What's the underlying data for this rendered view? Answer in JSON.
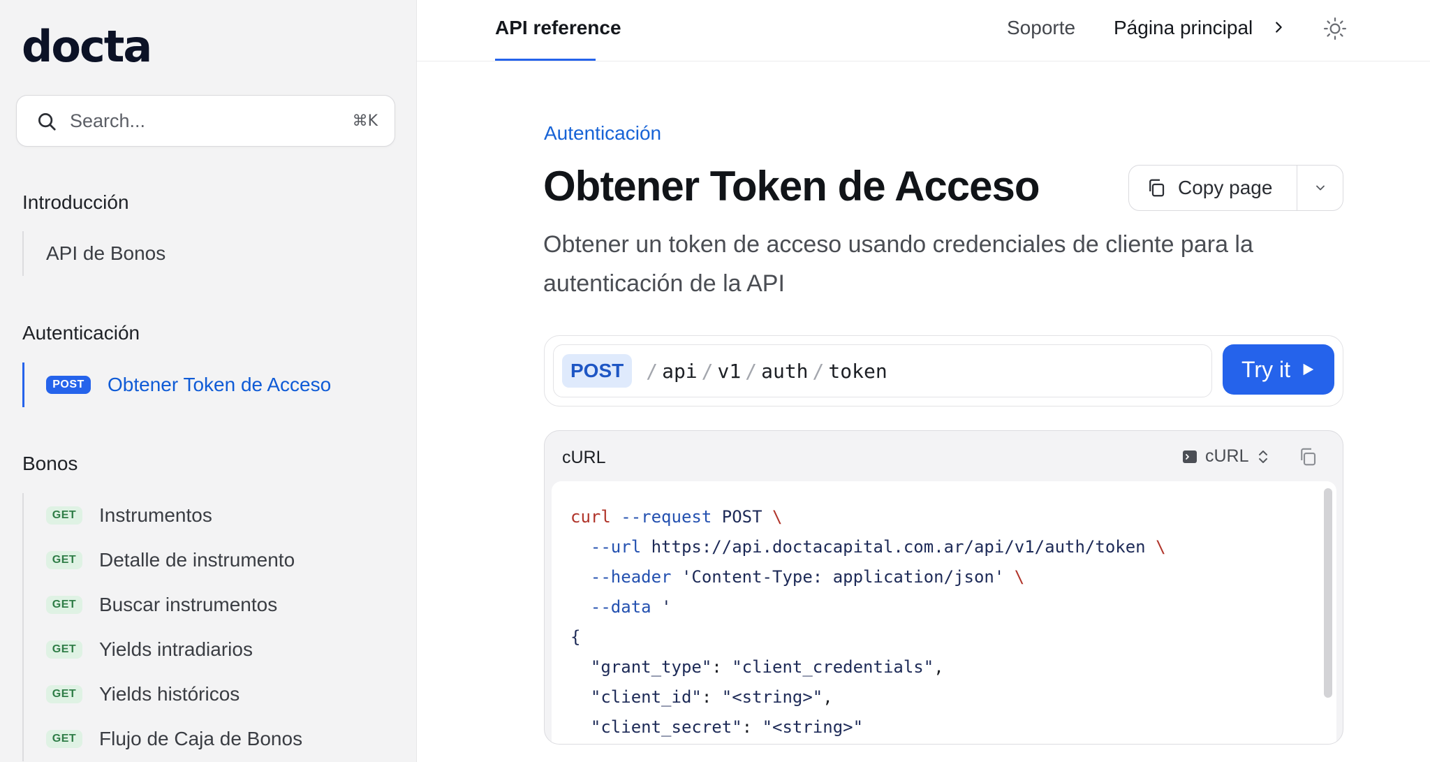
{
  "brand": {
    "logo_text": "docta"
  },
  "search": {
    "placeholder": "Search...",
    "shortcut": "⌘K"
  },
  "sidebar": {
    "sections": [
      {
        "heading": "Introducción",
        "items": [
          {
            "label": "API de Bonos"
          }
        ]
      },
      {
        "heading": "Autenticación",
        "items": [
          {
            "label": "Obtener Token de Acceso",
            "method": "POST",
            "active": true
          }
        ]
      },
      {
        "heading": "Bonos",
        "items": [
          {
            "label": "Instrumentos",
            "method": "GET"
          },
          {
            "label": "Detalle de instrumento",
            "method": "GET"
          },
          {
            "label": "Buscar instrumentos",
            "method": "GET"
          },
          {
            "label": "Yields intradiarios",
            "method": "GET"
          },
          {
            "label": "Yields históricos",
            "method": "GET"
          },
          {
            "label": "Flujo de Caja de Bonos",
            "method": "GET"
          }
        ]
      }
    ]
  },
  "topnav": {
    "active_tab": "API reference",
    "support_link": "Soporte",
    "home_link": "Página principal"
  },
  "page": {
    "breadcrumb": "Autenticación",
    "title": "Obtener Token de Acceso",
    "description": "Obtener un token de acceso usando credenciales de cliente para la autenticación de la API",
    "copy_button": "Copy page"
  },
  "endpoint": {
    "method": "POST",
    "path_segments": [
      "api",
      "v1",
      "auth",
      "token"
    ],
    "try_button": "Try it"
  },
  "code_panel": {
    "title": "cURL",
    "language": "cURL",
    "lines": {
      "l1_cmd": "curl",
      "l1_flag": "--request",
      "l1_val": "POST",
      "l2_flag": "--url",
      "l2_val": "https://api.doctacapital.com.ar/api/v1/auth/token",
      "l3_flag": "--header",
      "l3_val": "'Content-Type: application/json'",
      "l4_flag": "--data",
      "l4_val": "'",
      "l5": "{",
      "l6_key": "\"grant_type\"",
      "l6_val": "\"client_credentials\"",
      "l7_key": "\"client_id\"",
      "l7_val": "\"<string>\"",
      "l8_key": "\"client_secret\"",
      "l8_val": "\"<string>\"",
      "backslash": "\\"
    }
  },
  "colors": {
    "accent": "#2563eb",
    "get_badge_bg": "#dff2e4",
    "get_badge_text": "#2f7d47"
  }
}
